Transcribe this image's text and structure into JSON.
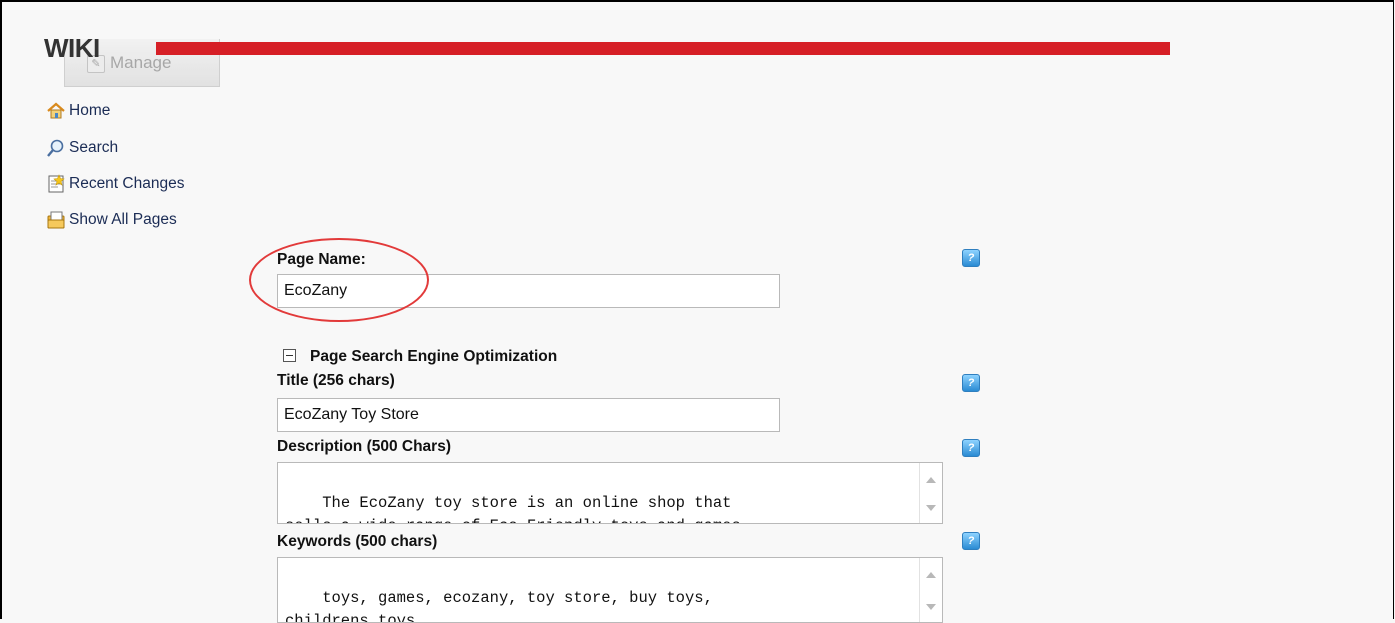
{
  "header": {
    "title": "WIKI",
    "manage_label": "Manage",
    "accent_color": "#d61f26"
  },
  "nav": {
    "items": [
      {
        "label": "Home",
        "icon": "home-icon"
      },
      {
        "label": "Search",
        "icon": "magnifier-icon"
      },
      {
        "label": "Recent Changes",
        "icon": "recent-changes-icon"
      },
      {
        "label": "Show All Pages",
        "icon": "pages-icon"
      }
    ]
  },
  "form": {
    "page_name_label": "Page Name:",
    "page_name_value": "EcoZany",
    "seo_section_label": "Page Search Engine Optimization",
    "title_label": "Title (256 chars)",
    "title_value": "EcoZany Toy Store",
    "description_label": "Description (500 Chars)",
    "description_value": "The EcoZany toy store is an online shop that\nsells a wide range of Eco-Friendly toys and games.",
    "keywords_label": "Keywords (500 chars)",
    "keywords_value": "toys, games, ecozany, toy store, buy toys,\nchildrens toys,",
    "help_glyph": "?"
  }
}
